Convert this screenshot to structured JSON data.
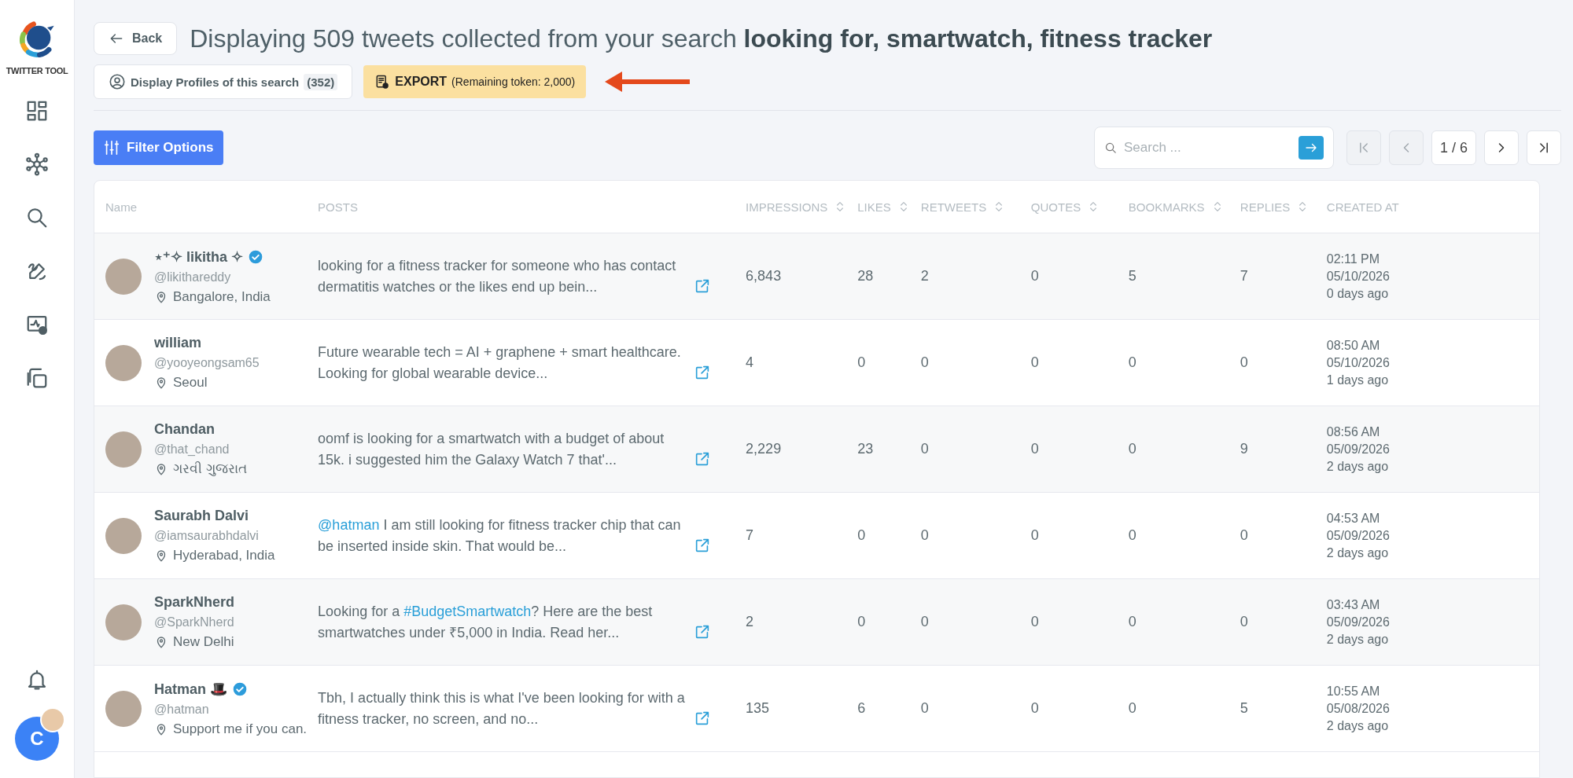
{
  "sidebar": {
    "logo_text": "TWITTER TOOL",
    "user_initial": "C"
  },
  "header": {
    "back_label": "Back",
    "title": "Displaying 509 tweets collected from your search **looking for, smartwatch, fitness tracker**"
  },
  "actions": {
    "profiles_label": "Display Profiles of this search",
    "profiles_count": "(352)",
    "export_label": "EXPORT",
    "export_note": "(Remaining token: 2,000)"
  },
  "toolbar": {
    "filter_label": "Filter Options",
    "search": {
      "placeholder": "Search ..."
    },
    "pagination": {
      "page": "1 / 6",
      "buttons": [
        {
          "kind": "first",
          "disabled": true
        },
        {
          "kind": "prev",
          "disabled": true
        },
        {
          "kind": "page"
        },
        {
          "kind": "next",
          "disabled": false
        },
        {
          "kind": "last",
          "disabled": false
        }
      ]
    }
  },
  "table": {
    "columns": [
      {
        "label": "Name",
        "sortable": false
      },
      {
        "label": "POSTS",
        "sortable": false
      },
      {
        "label": "IMPRESSIONS",
        "sortable": true
      },
      {
        "label": "LIKES",
        "sortable": true
      },
      {
        "label": "RETWEETS",
        "sortable": true
      },
      {
        "label": "QUOTES",
        "sortable": true
      },
      {
        "label": "BOOKMARKS",
        "sortable": true
      },
      {
        "label": "REPLIES",
        "sortable": true
      },
      {
        "label": "CREATED AT",
        "sortable": false
      }
    ],
    "rows": [
      {
        "name": "⋆⁺✧ likitha ✧",
        "verified": true,
        "handle": "@likithareddy",
        "location": "Bangalore, India",
        "post": [
          {
            "text": "looking for a fitness tracker for someone who has contact dermatitis watches or the likes end up bein...",
            "link": false
          }
        ],
        "impressions": "6,843",
        "likes": "28",
        "retweets": "2",
        "quotes": "0",
        "bookmarks": "5",
        "replies": "7",
        "time": "02:11 PM",
        "date": "05/10/2026",
        "ago": "0 days ago"
      },
      {
        "name": "william",
        "verified": false,
        "handle": "@yooyeongsam65",
        "location": "Seoul",
        "post": [
          {
            "text": "Future wearable tech = AI + graphene + smart healthcare. Looking for global wearable device...",
            "link": false
          }
        ],
        "impressions": "4",
        "likes": "0",
        "retweets": "0",
        "quotes": "0",
        "bookmarks": "0",
        "replies": "0",
        "time": "08:50 AM",
        "date": "05/10/2026",
        "ago": "1 days ago"
      },
      {
        "name": "Chandan",
        "verified": false,
        "handle": "@that_chand",
        "location": "ગરવી ગુજરાત",
        "post": [
          {
            "text": "oomf is looking for a smartwatch with a budget of about 15k. i suggested him the Galaxy Watch 7 that'...",
            "link": false
          }
        ],
        "impressions": "2,229",
        "likes": "23",
        "retweets": "0",
        "quotes": "0",
        "bookmarks": "0",
        "replies": "9",
        "time": "08:56 AM",
        "date": "05/09/2026",
        "ago": "2 days ago"
      },
      {
        "name": "Saurabh Dalvi",
        "verified": false,
        "handle": "@iamsaurabhdalvi",
        "location": "Hyderabad, India",
        "post": [
          {
            "text": "@hatman",
            "link": true
          },
          {
            "text": " I am still looking for fitness tracker chip that can be inserted inside skin. That would be...",
            "link": false
          }
        ],
        "impressions": "7",
        "likes": "0",
        "retweets": "0",
        "quotes": "0",
        "bookmarks": "0",
        "replies": "0",
        "time": "04:53 AM",
        "date": "05/09/2026",
        "ago": "2 days ago"
      },
      {
        "name": "SparkNherd",
        "verified": false,
        "handle": "@SparkNherd",
        "location": "New Delhi",
        "post": [
          {
            "text": "Looking for a ",
            "link": false
          },
          {
            "text": "#BudgetSmartwatch",
            "link": true
          },
          {
            "text": "? Here are the best smartwatches under ₹5,000 in India. Read her...",
            "link": false
          }
        ],
        "impressions": "2",
        "likes": "0",
        "retweets": "0",
        "quotes": "0",
        "bookmarks": "0",
        "replies": "0",
        "time": "03:43 AM",
        "date": "05/09/2026",
        "ago": "2 days ago"
      },
      {
        "name": "Hatman 🎩",
        "verified": true,
        "handle": "@hatman",
        "location": "Support me if you can.",
        "post": [
          {
            "text": "Tbh, I actually think this is what I've been looking for with a fitness tracker, no screen, and no...",
            "link": false
          }
        ],
        "impressions": "135",
        "likes": "6",
        "retweets": "0",
        "quotes": "0",
        "bookmarks": "0",
        "replies": "5",
        "time": "10:55 AM",
        "date": "05/08/2026",
        "ago": "2 days ago"
      }
    ]
  }
}
